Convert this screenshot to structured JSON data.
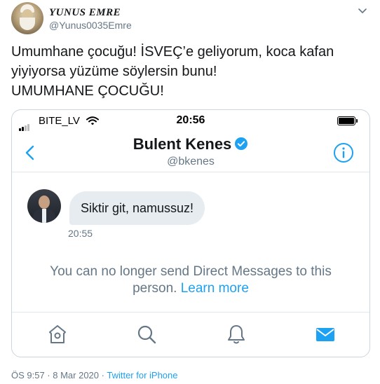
{
  "author": {
    "display_name": "YUNUS EMRE",
    "handle": "@Yunus0035Emre",
    "avatar_icon": "portrait-avatar"
  },
  "tweet": {
    "lines": [
      "Umumhane çocuğu! İSVEÇ’e geliyorum, koca kafan",
      "yiyiyorsa yüzüme söylersin bunu!",
      "UMUMHANE ÇOCUĞU!"
    ],
    "timestamp": "ÖS 9:57 · 8 Mar 2020",
    "separator": " · ",
    "source": "Twitter for iPhone"
  },
  "screenshot": {
    "status_bar": {
      "carrier": "BITE_LV",
      "time": "20:56"
    },
    "header": {
      "name": "Bulent Kenes",
      "handle": "@bkenes"
    },
    "message": {
      "text": "Siktir git, namussuz!",
      "time": "20:55"
    },
    "notice": {
      "text": "You can no longer send Direct Messages to this person. ",
      "link": "Learn more"
    },
    "tabs": [
      "home-icon",
      "search-icon",
      "notifications-icon",
      "messages-icon"
    ]
  },
  "colors": {
    "accent": "#1da1f2",
    "secondary_text": "#657786",
    "bubble": "#e6ecf0"
  }
}
